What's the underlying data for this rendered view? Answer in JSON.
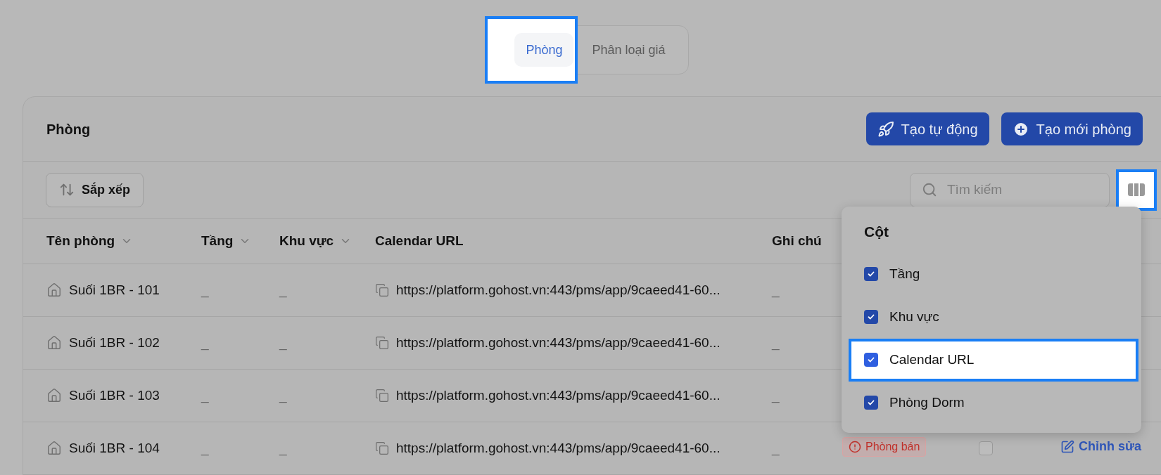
{
  "tabs": [
    {
      "label": "Phòng",
      "selected": true,
      "spotlight": true
    },
    {
      "label": "Phân loại giá",
      "selected": false,
      "spotlight": false
    }
  ],
  "card": {
    "title": "Phòng",
    "actions": [
      {
        "label": "Tạo tự động",
        "kind": "rocket"
      },
      {
        "label": "Tạo mới phòng",
        "kind": "plus"
      }
    ]
  },
  "toolbar": {
    "sort_label": "Sắp xếp",
    "search": {
      "placeholder": "Tìm kiếm"
    },
    "column_button": {
      "spotlight": true
    }
  },
  "table": {
    "columns": [
      {
        "label": "Tên phòng",
        "sortable": true
      },
      {
        "label": "Tầng",
        "sortable": true
      },
      {
        "label": "Khu vực",
        "sortable": true
      },
      {
        "label": "Calendar URL",
        "sortable": false
      },
      {
        "label": "Ghi chú",
        "sortable": false
      }
    ],
    "rows": [
      {
        "name": "Suối 1BR - 101",
        "floor": "_",
        "area": "_",
        "url": "https://platform.gohost.vn:443/pms/app/9caeed41-60...",
        "note": "_"
      },
      {
        "name": "Suối 1BR - 102",
        "floor": "_",
        "area": "_",
        "url": "https://platform.gohost.vn:443/pms/app/9caeed41-60...",
        "note": "_"
      },
      {
        "name": "Suối 1BR - 103",
        "floor": "_",
        "area": "_",
        "url": "https://platform.gohost.vn:443/pms/app/9caeed41-60...",
        "note": "_"
      },
      {
        "name": "Suối 1BR - 104",
        "floor": "_",
        "area": "_",
        "url": "https://platform.gohost.vn:443/pms/app/9caeed41-60...",
        "note": "_",
        "status": "Phòng bán",
        "dorm": false,
        "edit": "Chỉnh sửa"
      }
    ]
  },
  "column_menu": {
    "title": "Cột",
    "items": [
      {
        "label": "Tầng",
        "checked": true,
        "spotlight": false
      },
      {
        "label": "Khu vực",
        "checked": true,
        "spotlight": false
      },
      {
        "label": "Calendar URL",
        "checked": true,
        "spotlight": true
      },
      {
        "label": "Phòng Dorm",
        "checked": true,
        "spotlight": false
      }
    ]
  }
}
